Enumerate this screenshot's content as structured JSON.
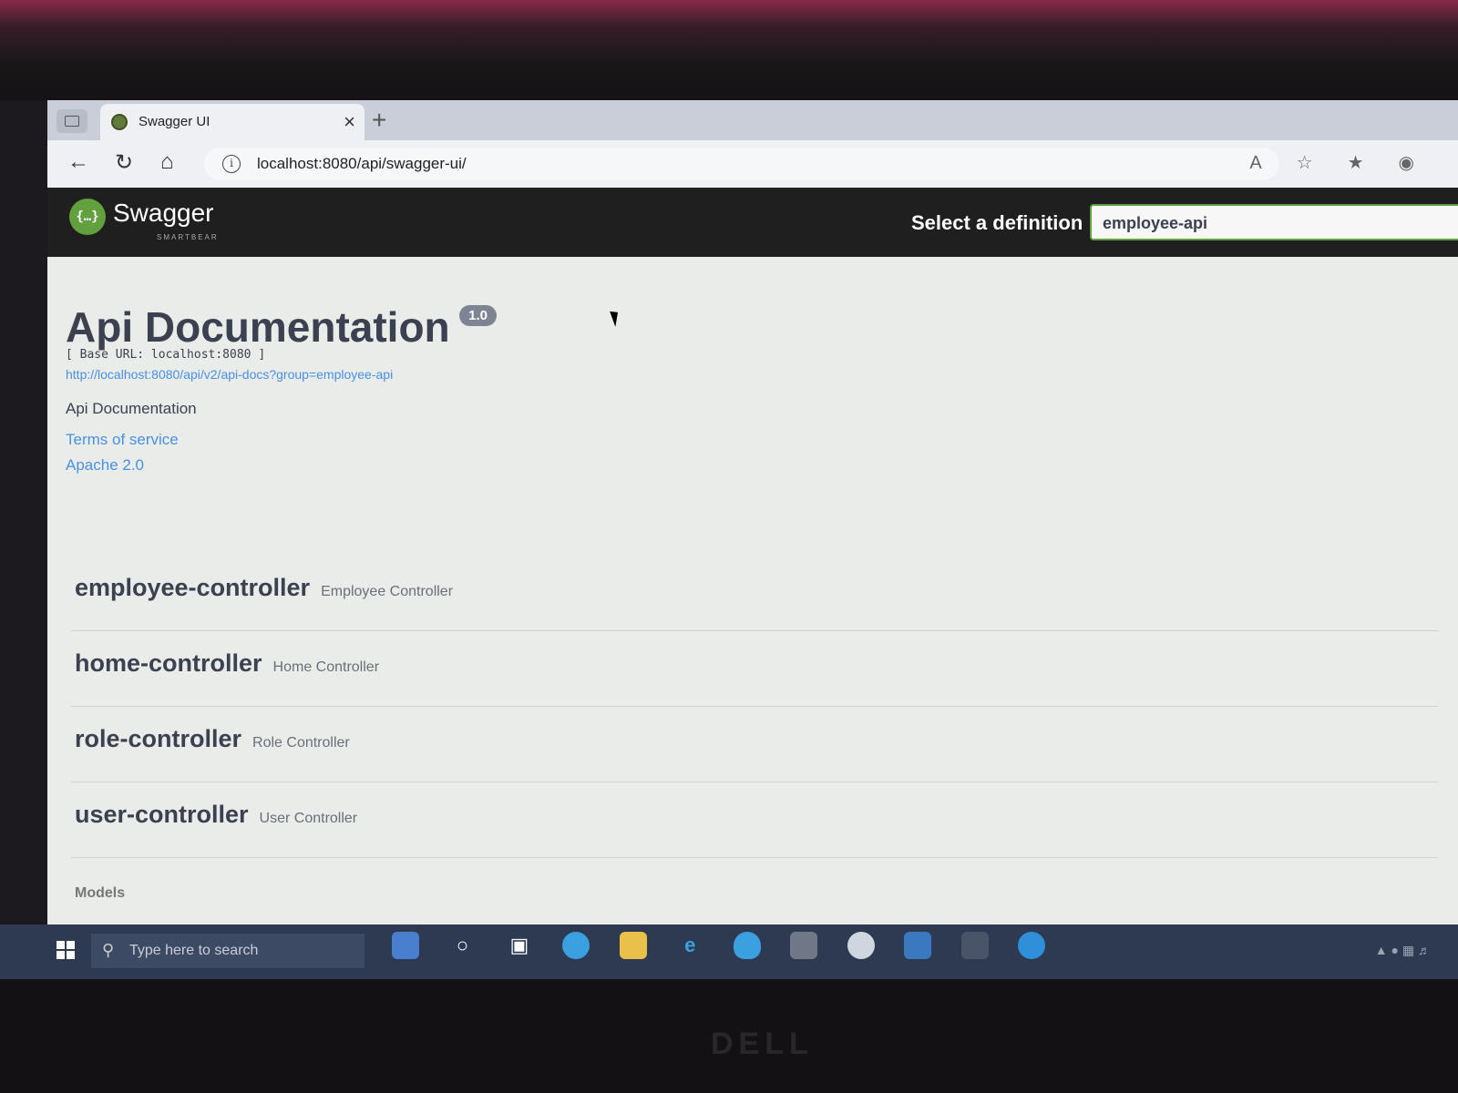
{
  "browser": {
    "tab_title": "Swagger UI",
    "tab_close": "×",
    "new_tab": "+",
    "url": "localhost:8080/api/swagger-ui/",
    "info_glyph": "i",
    "nav_icons": [
      "back-icon",
      "refresh-icon",
      "home-icon"
    ],
    "toolbar_icons": [
      "read-aloud-icon",
      "favorites-add-icon",
      "collections-icon",
      "profile-icon"
    ]
  },
  "swagger": {
    "brand": "Swagger",
    "brand_sub": "SMARTBEAR",
    "logo_glyph": "{…}",
    "select_label": "Select a definition",
    "selected_definition": "employee-api",
    "accent_color": "#62a03f"
  },
  "info": {
    "title": "Api Documentation",
    "version": "1.0",
    "base_url": "[ Base URL: localhost:8080 ]",
    "docs_url": "http://localhost:8080/api/v2/api-docs?group=employee-api",
    "description": "Api Documentation",
    "terms": "Terms of service",
    "license": "Apache 2.0"
  },
  "controllers": [
    {
      "name": "employee-controller",
      "description": "Employee Controller"
    },
    {
      "name": "home-controller",
      "description": "Home Controller"
    },
    {
      "name": "role-controller",
      "description": "Role Controller"
    },
    {
      "name": "user-controller",
      "description": "User Controller"
    }
  ],
  "models_label": "Models",
  "taskbar": {
    "search_placeholder": "Type here to search",
    "pinned": [
      "widgets-icon",
      "cortana-icon",
      "task-view-icon",
      "edge-icon",
      "file-explorer-icon",
      "ie-icon",
      "security-icon",
      "app-icon",
      "chrome-icon",
      "store-icon",
      "terminal-icon",
      "edge-active-icon"
    ]
  },
  "brand_mark": "DELL"
}
